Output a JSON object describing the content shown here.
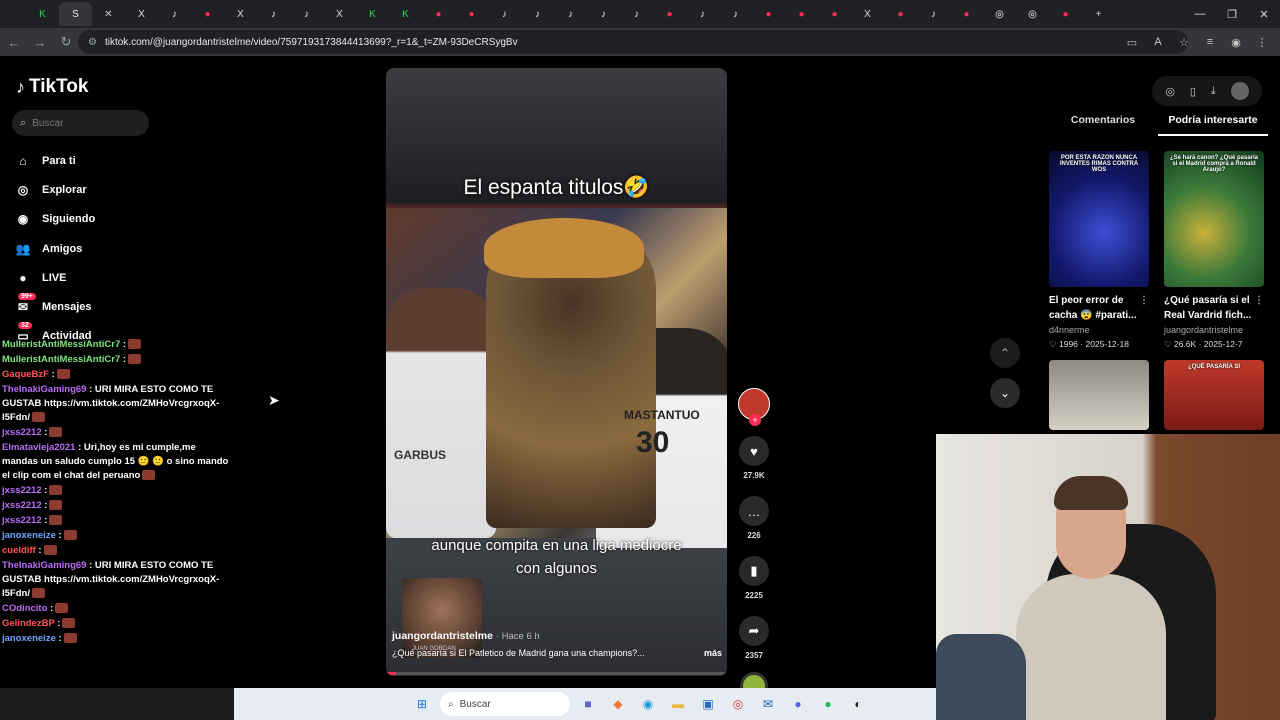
{
  "browser": {
    "url": "tiktok.com/@juangordantristelme/video/7597193173844413699?_r=1&_t=ZM-93DeCRSygBv",
    "tab_glyphs": [
      "K",
      "S",
      "✕",
      "X",
      "♪",
      "●",
      "X",
      "♪",
      "♪",
      "X",
      "K",
      "K",
      "●",
      "●",
      "♪",
      "♪",
      "♪",
      "♪",
      "♪",
      "●",
      "♪",
      "♪",
      "●",
      "●",
      "●",
      "X",
      "●",
      "♪",
      "●",
      "◎",
      "◎",
      "●"
    ],
    "window_controls": [
      "—",
      "❐",
      "✕"
    ],
    "new_tab": "+"
  },
  "app": {
    "brand": "TikTok",
    "search_placeholder": "Buscar",
    "nav": [
      {
        "label": "Para ti",
        "icon": "home-icon",
        "glyph": "⌂"
      },
      {
        "label": "Explorar",
        "icon": "compass-icon",
        "glyph": "◎"
      },
      {
        "label": "Siguiendo",
        "icon": "following-avatar-icon",
        "glyph": "◉"
      },
      {
        "label": "Amigos",
        "icon": "friends-icon",
        "glyph": "👥"
      },
      {
        "label": "LIVE",
        "icon": "live-icon",
        "glyph": "●"
      },
      {
        "label": "Mensajes",
        "icon": "messages-icon",
        "glyph": "✉",
        "badge": "99+"
      },
      {
        "label": "Actividad",
        "icon": "activity-icon",
        "glyph": "▭",
        "badge": "32"
      }
    ]
  },
  "chat": [
    {
      "user": "MulleristAntiMessiAntiCr7",
      "text": ":",
      "color": "g"
    },
    {
      "user": "MulleristAntiMessiAntiCr7",
      "text": ":",
      "color": "g"
    },
    {
      "user": "GaqueBzF",
      "text": ":",
      "color": "r"
    },
    {
      "user": "TheInakiGaming69",
      "text": ": URI MIRA ESTO COMO TE GUSTAB https://vm.tiktok.com/ZMHoVrcgrxoqX-I5Fdn/",
      "color": "p"
    },
    {
      "user": "jxss2212",
      "text": ":",
      "color": "p"
    },
    {
      "user": "Elmatavieja2021",
      "text": ": Uri,hoy es mi cumple,me mandas un saludo cumplo 15 🙂 🙂 o sino mando el clip com el chat del peruano",
      "color": "p"
    },
    {
      "user": "jxss2212",
      "text": ":",
      "color": "p"
    },
    {
      "user": "jxss2212",
      "text": ":",
      "color": "p"
    },
    {
      "user": "jxss2212",
      "text": ":",
      "color": "p"
    },
    {
      "user": "janoxeneize",
      "text": ":",
      "color": "b"
    },
    {
      "user": "cueldiff",
      "text": ":",
      "color": "r"
    },
    {
      "user": "TheInakiGaming69",
      "text": ": URI MIRA ESTO COMO TE GUSTAB https://vm.tiktok.com/ZMHoVrcgrxoqX-I5Fdn/",
      "color": "p"
    },
    {
      "user": "COdincito",
      "text": ":",
      "color": "p"
    },
    {
      "user": "GelindezBP",
      "text": ":",
      "color": "r"
    },
    {
      "user": "janoxeneize",
      "text": ":",
      "color": "b"
    }
  ],
  "video": {
    "overlay_title": "El espanta titulos🤣",
    "subtitle_line1": "aunque compita en una liga mediocre",
    "subtitle_line2": "con algunos",
    "jersey_name": "MASTANTUO",
    "jersey_number": "30",
    "left_jersey": "GARBUS",
    "inset_name": "JUAN GORDAN",
    "author": "juangordantristelme",
    "time": "· Hace 6 h",
    "description": "¿Qué pasaría si El Patletico de Madrid gana una champions?...",
    "more": "más",
    "progress": 0.03
  },
  "actions": {
    "likes": "27.9K",
    "comments": "226",
    "saves": "2225",
    "shares": "2357"
  },
  "right_panel": {
    "tabs": [
      "Comentarios",
      "Podría interesarte"
    ],
    "active_tab": 1,
    "cards": [
      {
        "thumb_text": "POR ESTA RAZON NUNCA INVENTES RIMAS CONTRA WOS",
        "title": "El peor error de cacha 😨 #parati...",
        "author": "d4nnerme",
        "likes": "1996",
        "date": "2025-12-18"
      },
      {
        "thumb_text": "¿Se hará canon? ¿Qué pasaría si el Madrid compra a Ronald Araujo?",
        "title": "¿Qué pasaría si el Real Vardrid fich...",
        "author": "juangordantristelme",
        "likes": "26.6K",
        "date": "2025-12-7"
      },
      {
        "thumb_text": "",
        "title": "",
        "author": "",
        "likes": "",
        "date": ""
      },
      {
        "thumb_text": "¿QUÉ PASARÍA SI",
        "title": "",
        "author": "",
        "likes": "",
        "date": ""
      }
    ]
  },
  "taskbar": {
    "search_placeholder": "Buscar"
  }
}
